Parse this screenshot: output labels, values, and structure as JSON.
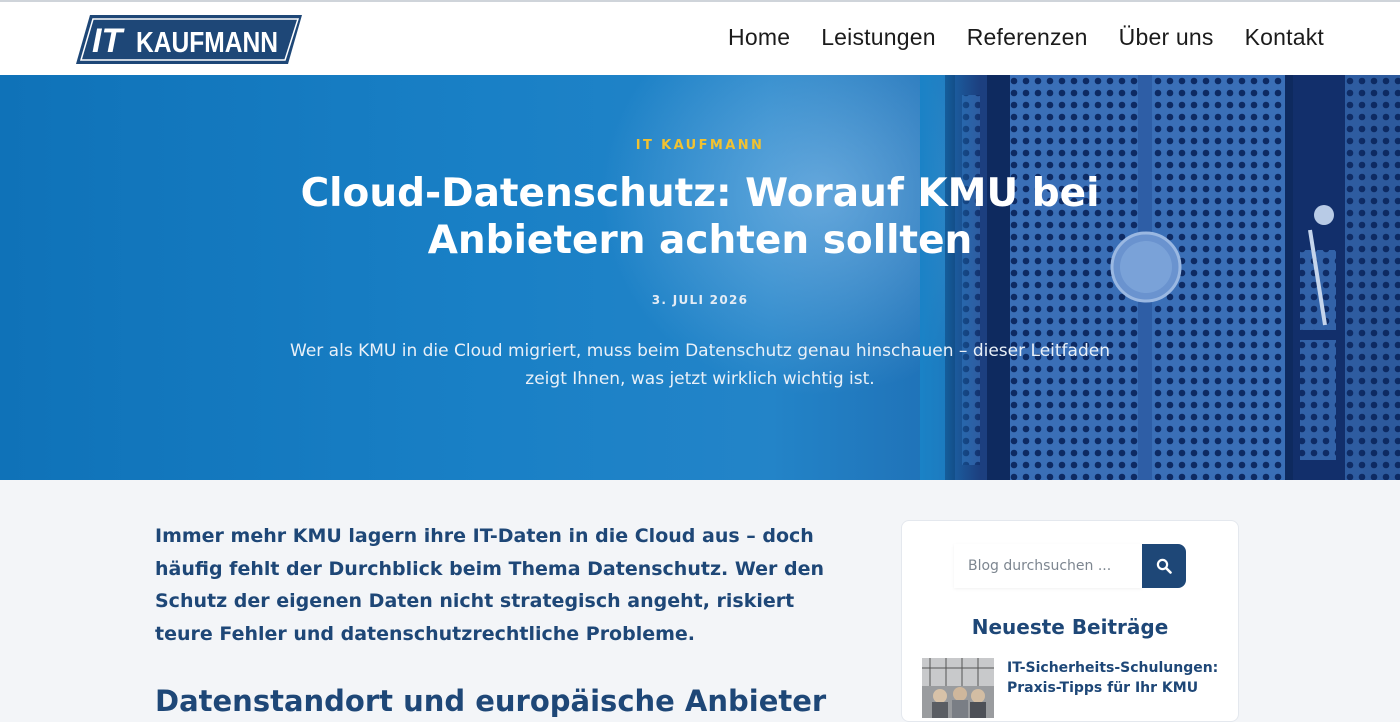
{
  "header": {
    "logo": {
      "alt": "IT KAUFMANN",
      "text_it": "IT",
      "text_name": "KAUFMANN",
      "color": "#1e4777"
    },
    "nav": [
      {
        "label": "Home"
      },
      {
        "label": "Leistungen"
      },
      {
        "label": "Referenzen"
      },
      {
        "label": "Über uns"
      },
      {
        "label": "Kontakt"
      }
    ]
  },
  "hero": {
    "kicker": "IT KAUFMANN",
    "title": "Cloud-Datenschutz: Worauf KMU bei Anbietern achten sollten",
    "date": "3. JULI 2026",
    "lead": "Wer als KMU in die Cloud migriert, muss beim Datenschutz genau hinschauen – dieser Leitfaden zeigt Ihnen, was jetzt wirklich wichtig ist.",
    "kicker_color": "#f2c230"
  },
  "article": {
    "intro": "Immer mehr KMU lagern ihre IT-Daten in die Cloud aus – doch häufig fehlt der Durchblick beim Thema Datenschutz. Wer den Schutz der eigenen Daten nicht strategisch angeht, riskiert teure Fehler und datenschutzrechtliche Probleme.",
    "h2": "Datenstandort und europäische Anbieter"
  },
  "sidebar": {
    "search": {
      "placeholder": "Blog durchsuchen ...",
      "button_icon": "search-icon"
    },
    "recent_title": "Neueste Beiträge",
    "posts": [
      {
        "title": "IT-Sicherheits-Schulungen: Praxis-Tipps für Ihr KMU"
      }
    ]
  },
  "colors": {
    "brand": "#1e4777",
    "accent": "#f2c230",
    "page_bg": "#f3f5f8"
  }
}
